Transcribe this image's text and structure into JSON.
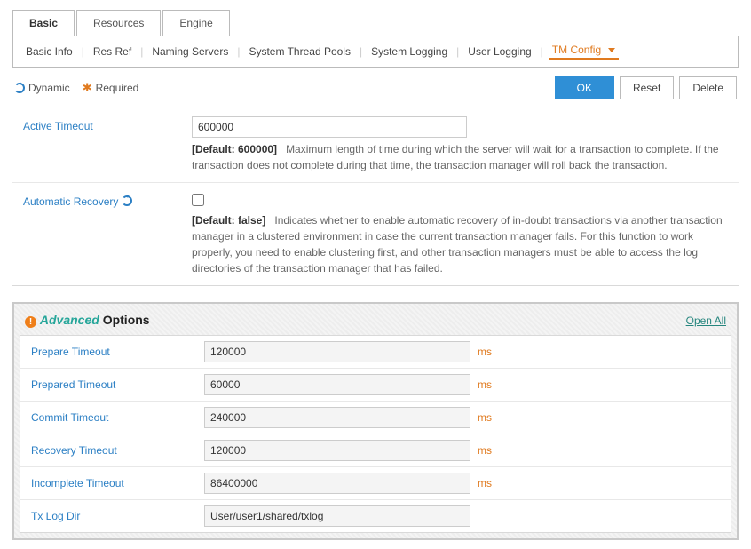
{
  "tabs": {
    "basic": "Basic",
    "resources": "Resources",
    "engine": "Engine"
  },
  "subtabs": {
    "basic_info": "Basic Info",
    "res_ref": "Res Ref",
    "naming_servers": "Naming Servers",
    "system_thread_pools": "System Thread Pools",
    "system_logging": "System Logging",
    "user_logging": "User Logging",
    "tm_config": "TM Config"
  },
  "legend": {
    "dynamic": "Dynamic",
    "required": "Required"
  },
  "buttons": {
    "ok": "OK",
    "reset": "Reset",
    "delete": "Delete"
  },
  "fields": {
    "active_timeout": {
      "label": "Active Timeout",
      "value": "600000",
      "default_label": "[Default: 600000]",
      "desc": "Maximum length of time during which the server will wait for a transaction to complete. If the transaction does not complete during that time, the transaction manager will roll back the transaction."
    },
    "automatic_recovery": {
      "label": "Automatic Recovery",
      "checked": false,
      "default_label": "[Default: false]",
      "desc": "Indicates whether to enable automatic recovery of in-doubt transactions via another transaction manager in a clustered environment in case the current transaction manager fails. For this function to work properly, you need to enable clustering first, and other transaction managers must be able to access the log directories of the transaction manager that has failed."
    }
  },
  "advanced": {
    "title_adv": "Advanced",
    "title_opts": "Options",
    "open_all": "Open All",
    "rows": {
      "prepare_timeout": {
        "label": "Prepare Timeout",
        "value": "120000",
        "unit": "ms"
      },
      "prepared_timeout": {
        "label": "Prepared Timeout",
        "value": "60000",
        "unit": "ms"
      },
      "commit_timeout": {
        "label": "Commit Timeout",
        "value": "240000",
        "unit": "ms"
      },
      "recovery_timeout": {
        "label": "Recovery Timeout",
        "value": "120000",
        "unit": "ms"
      },
      "incomplete_timeout": {
        "label": "Incomplete Timeout",
        "value": "86400000",
        "unit": "ms"
      },
      "tx_log_dir": {
        "label": "Tx Log Dir",
        "value": "User/user1/shared/txlog",
        "unit": ""
      }
    }
  }
}
